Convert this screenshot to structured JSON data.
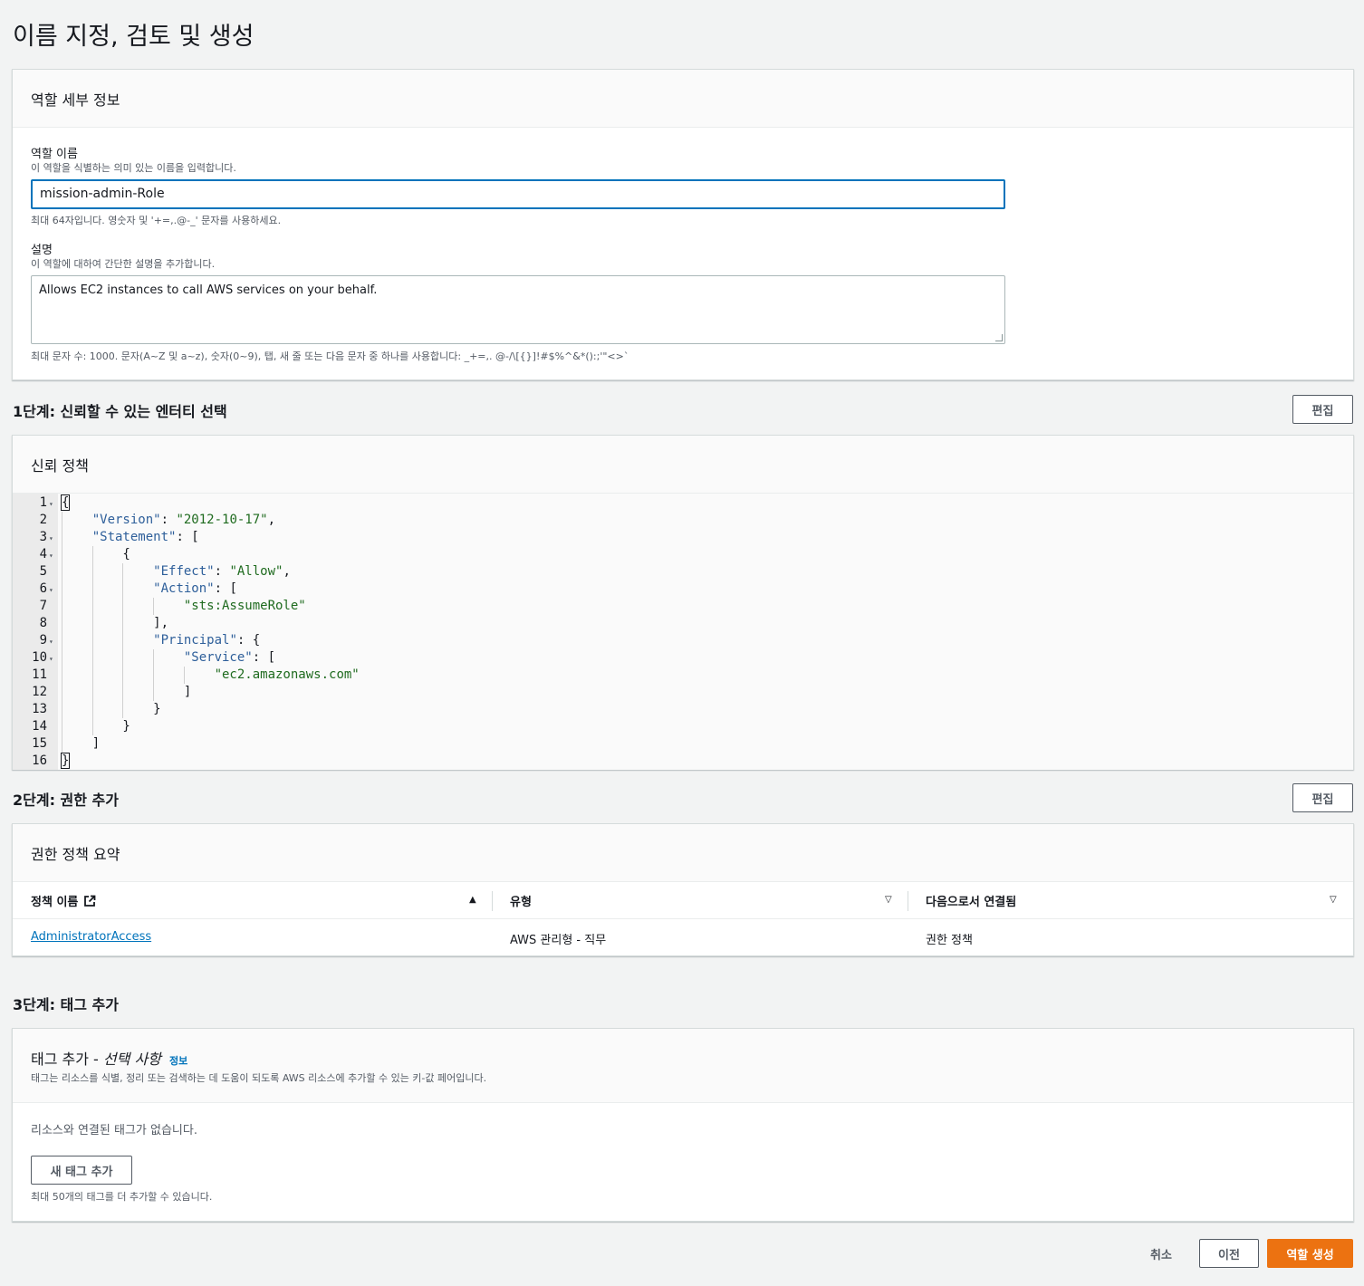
{
  "page_title": "이름 지정, 검토 및 생성",
  "role_details": {
    "header": "역할 세부 정보",
    "name_label": "역할 이름",
    "name_desc": "이 역할을 식별하는 의미 있는 이름을 입력합니다.",
    "name_value": "mission-admin-Role",
    "name_constraint": "최대 64자입니다. 영숫자 및 '+=,.@-_' 문자를 사용하세요.",
    "desc_label": "설명",
    "desc_desc": "이 역할에 대하여 간단한 설명을 추가합니다.",
    "desc_value": "Allows EC2 instances to call AWS services on your behalf.",
    "desc_constraint": "최대 문자 수: 1000. 문자(A~Z 및 a~z), 숫자(0~9), 탭, 새 줄 또는 다음 문자 중 하나를 사용합니다: _+=,. @-/\\[{}]!#$%^&*():;'\"<>`"
  },
  "step1": {
    "heading": "1단계: 신뢰할 수 있는 엔터티 선택",
    "edit_label": "편집",
    "card_header": "신뢰 정책",
    "code_lines": [
      {
        "n": "1",
        "fold": true,
        "text": "{"
      },
      {
        "n": "2",
        "fold": false,
        "text": "    \"Version\": \"2012-10-17\","
      },
      {
        "n": "3",
        "fold": true,
        "text": "    \"Statement\": ["
      },
      {
        "n": "4",
        "fold": true,
        "text": "        {"
      },
      {
        "n": "5",
        "fold": false,
        "text": "            \"Effect\": \"Allow\","
      },
      {
        "n": "6",
        "fold": true,
        "text": "            \"Action\": ["
      },
      {
        "n": "7",
        "fold": false,
        "text": "                \"sts:AssumeRole\""
      },
      {
        "n": "8",
        "fold": false,
        "text": "            ],"
      },
      {
        "n": "9",
        "fold": true,
        "text": "            \"Principal\": {"
      },
      {
        "n": "10",
        "fold": true,
        "text": "                \"Service\": ["
      },
      {
        "n": "11",
        "fold": false,
        "text": "                    \"ec2.amazonaws.com\""
      },
      {
        "n": "12",
        "fold": false,
        "text": "                ]"
      },
      {
        "n": "13",
        "fold": false,
        "text": "            }"
      },
      {
        "n": "14",
        "fold": false,
        "text": "        }"
      },
      {
        "n": "15",
        "fold": false,
        "text": "    ]"
      },
      {
        "n": "16",
        "fold": false,
        "text": "}"
      }
    ]
  },
  "step2": {
    "heading": "2단계: 권한 추가",
    "edit_label": "편집",
    "card_header": "권한 정책 요약",
    "columns": [
      "정책 이름",
      "유형",
      "다음으로서 연결됨"
    ],
    "rows": [
      {
        "policy": "AdministratorAccess",
        "type": "AWS 관리형 - 직무",
        "attached_as": "권한 정책"
      }
    ]
  },
  "step3": {
    "heading": "3단계: 태그 추가",
    "card_title_main": "태그 추가 - ",
    "card_title_italic": "선택 사항",
    "info_label": "정보",
    "card_desc": "태그는 리소스를 식별, 정리 또는 검색하는 데 도움이 되도록 AWS 리소스에 추가할 수 있는 키-값 페어입니다.",
    "empty_text": "리소스와 연결된 태그가 없습니다.",
    "add_tag_label": "새 태그 추가",
    "limit_text": "최대 50개의 태그를 더 추가할 수 있습니다."
  },
  "footer": {
    "cancel_label": "취소",
    "previous_label": "이전",
    "create_label": "역할 생성"
  },
  "colors": {
    "primary": "#ec7211",
    "link": "#0073bb",
    "focus": "#0073bb"
  }
}
